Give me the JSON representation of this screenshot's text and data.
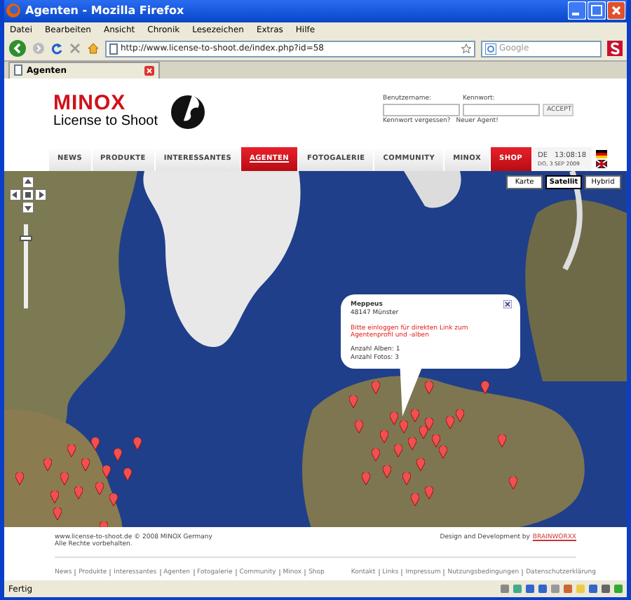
{
  "window": {
    "title": "Agenten - Mozilla Firefox"
  },
  "menu": [
    "Datei",
    "Bearbeiten",
    "Ansicht",
    "Chronik",
    "Lesezeichen",
    "Extras",
    "Hilfe"
  ],
  "toolbar": {
    "url": "http://www.license-to-shoot.de/index.php?id=58",
    "search_placeholder": "Google"
  },
  "tabs": [
    {
      "label": "Agenten",
      "selected": true
    }
  ],
  "header": {
    "brand": "MINOX",
    "tagline": "License to Shoot",
    "login": {
      "username_label": "Benutzername:",
      "password_label": "Kennwort:",
      "submit": "ACCEPT",
      "forgot": "Kennwort vergessen?",
      "new_agent": "Neuer Agent!"
    }
  },
  "nav": [
    {
      "label": "NEWS",
      "kind": "link",
      "selected": false
    },
    {
      "label": "PRODUKTE",
      "kind": "link",
      "selected": false
    },
    {
      "label": "INTERESSANTES",
      "kind": "link",
      "selected": false
    },
    {
      "label": "AGENTEN",
      "kind": "link",
      "selected": true
    },
    {
      "label": "FOTOGALERIE",
      "kind": "link",
      "selected": false
    },
    {
      "label": "COMMUNITY",
      "kind": "link",
      "selected": false
    },
    {
      "label": "MINOX",
      "kind": "link",
      "selected": false
    },
    {
      "label": "SHOP",
      "kind": "shop",
      "selected": false
    }
  ],
  "clock": {
    "country": "DE",
    "time": "13:08:18",
    "date": "DO, 3 SEP 2009"
  },
  "map": {
    "types": [
      {
        "label": "Karte",
        "selected": false
      },
      {
        "label": "Satellit",
        "selected": true
      },
      {
        "label": "Hybrid",
        "selected": false
      }
    ],
    "zoom_slider": {
      "level": 0.85
    },
    "popup": {
      "name": "Meppeus",
      "place": "48147 Münster",
      "notice": "Bitte einloggen für direkten Link zum Agentenprofil und -alben",
      "albums": "Anzahl Alben: 1",
      "photos": "Anzahl Fotos: 3"
    }
  },
  "footer": {
    "copyright": "www.license-to-shoot.de © 2008 MINOX Germany",
    "rights": "Alle Rechte vorbehalten.",
    "credit": "Design and Development by",
    "credit_link": "BRAINWORXX",
    "links_left": [
      "News",
      "Produkte",
      "Interessantes",
      "Agenten",
      "Fotogalerie",
      "Community",
      "Minox",
      "Shop"
    ],
    "links_right": [
      "Kontakt",
      "Links",
      "Impressum",
      "Nutzungsbedingungen",
      "Datenschutzerklärung"
    ]
  },
  "status_bar": {
    "text": "Fertig"
  }
}
